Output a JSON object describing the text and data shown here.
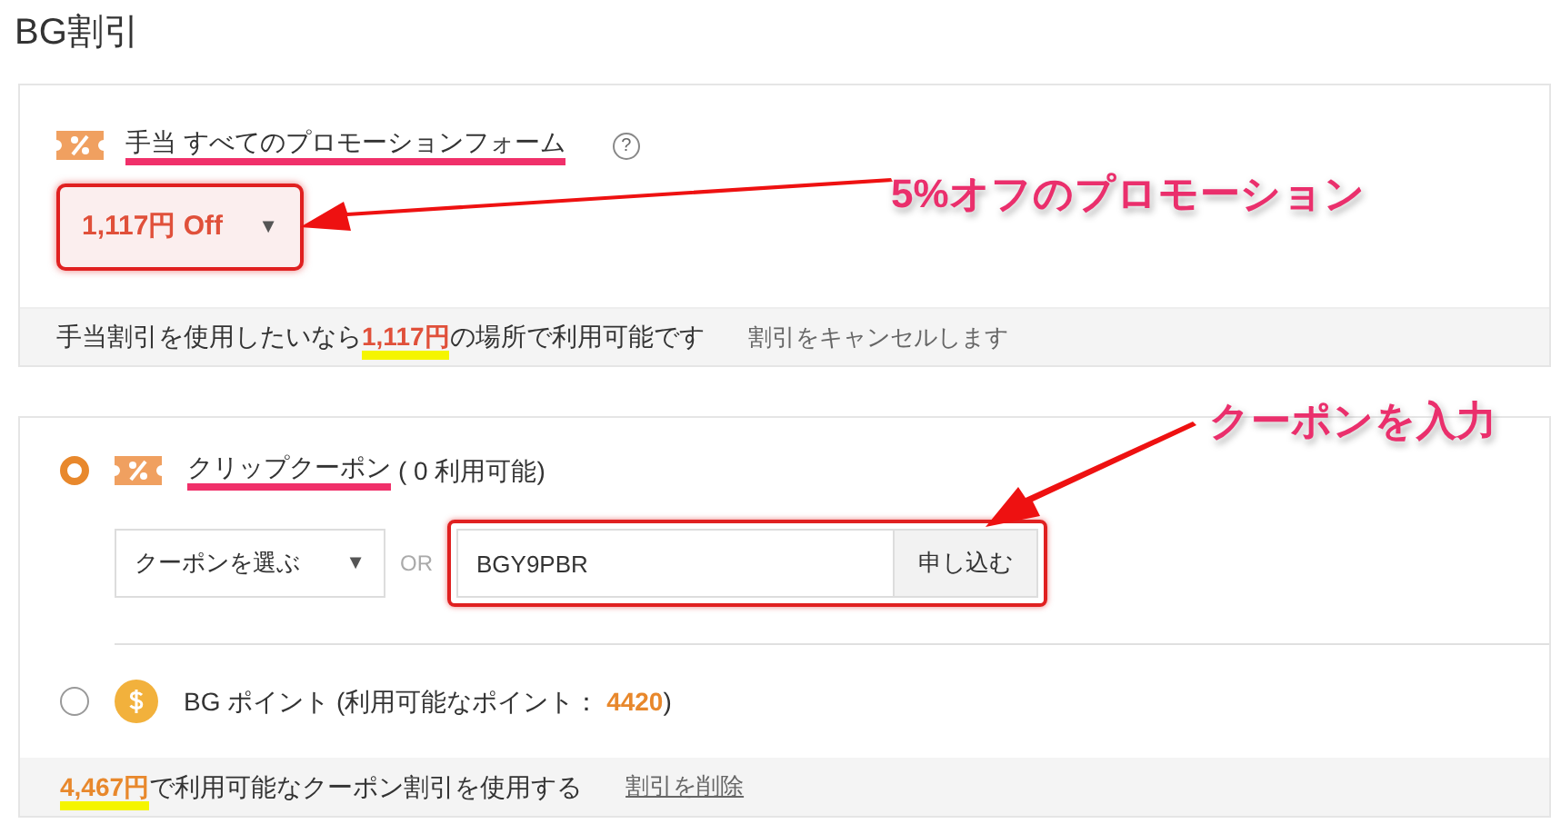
{
  "page_title": "BG割引",
  "promotion": {
    "label": "手当 すべてのプロモーションフォーム",
    "help": "?",
    "dropdown_value": "1,117円 Off",
    "caret": "▼",
    "footer": {
      "before": "手当割引を使用したいなら",
      "amount": "1,117円",
      "after": "の場所で利用可能です"
    },
    "cancel_link": "割引をキャンセルします"
  },
  "options": [
    {
      "kind": "coupon",
      "selected": true,
      "label": "クリップクーポン",
      "count": "( 0 利用可能)",
      "select_placeholder": "クーポンを選ぶ",
      "caret": "▼",
      "or": "OR",
      "code": "BGY9PBR",
      "apply": "申し込む"
    },
    {
      "kind": "points",
      "selected": false,
      "label": "BG ポイント (利用可能なポイント： ",
      "points": "4420",
      "close": ")"
    }
  ],
  "coupon_footer": {
    "amount": "4,467円",
    "after": "で利用可能なクーポン割引を使用する",
    "remove_link": "割引を削除"
  },
  "annotations": [
    {
      "text": "5%オフのプロモーション"
    },
    {
      "text": "クーポンを入力"
    }
  ]
}
